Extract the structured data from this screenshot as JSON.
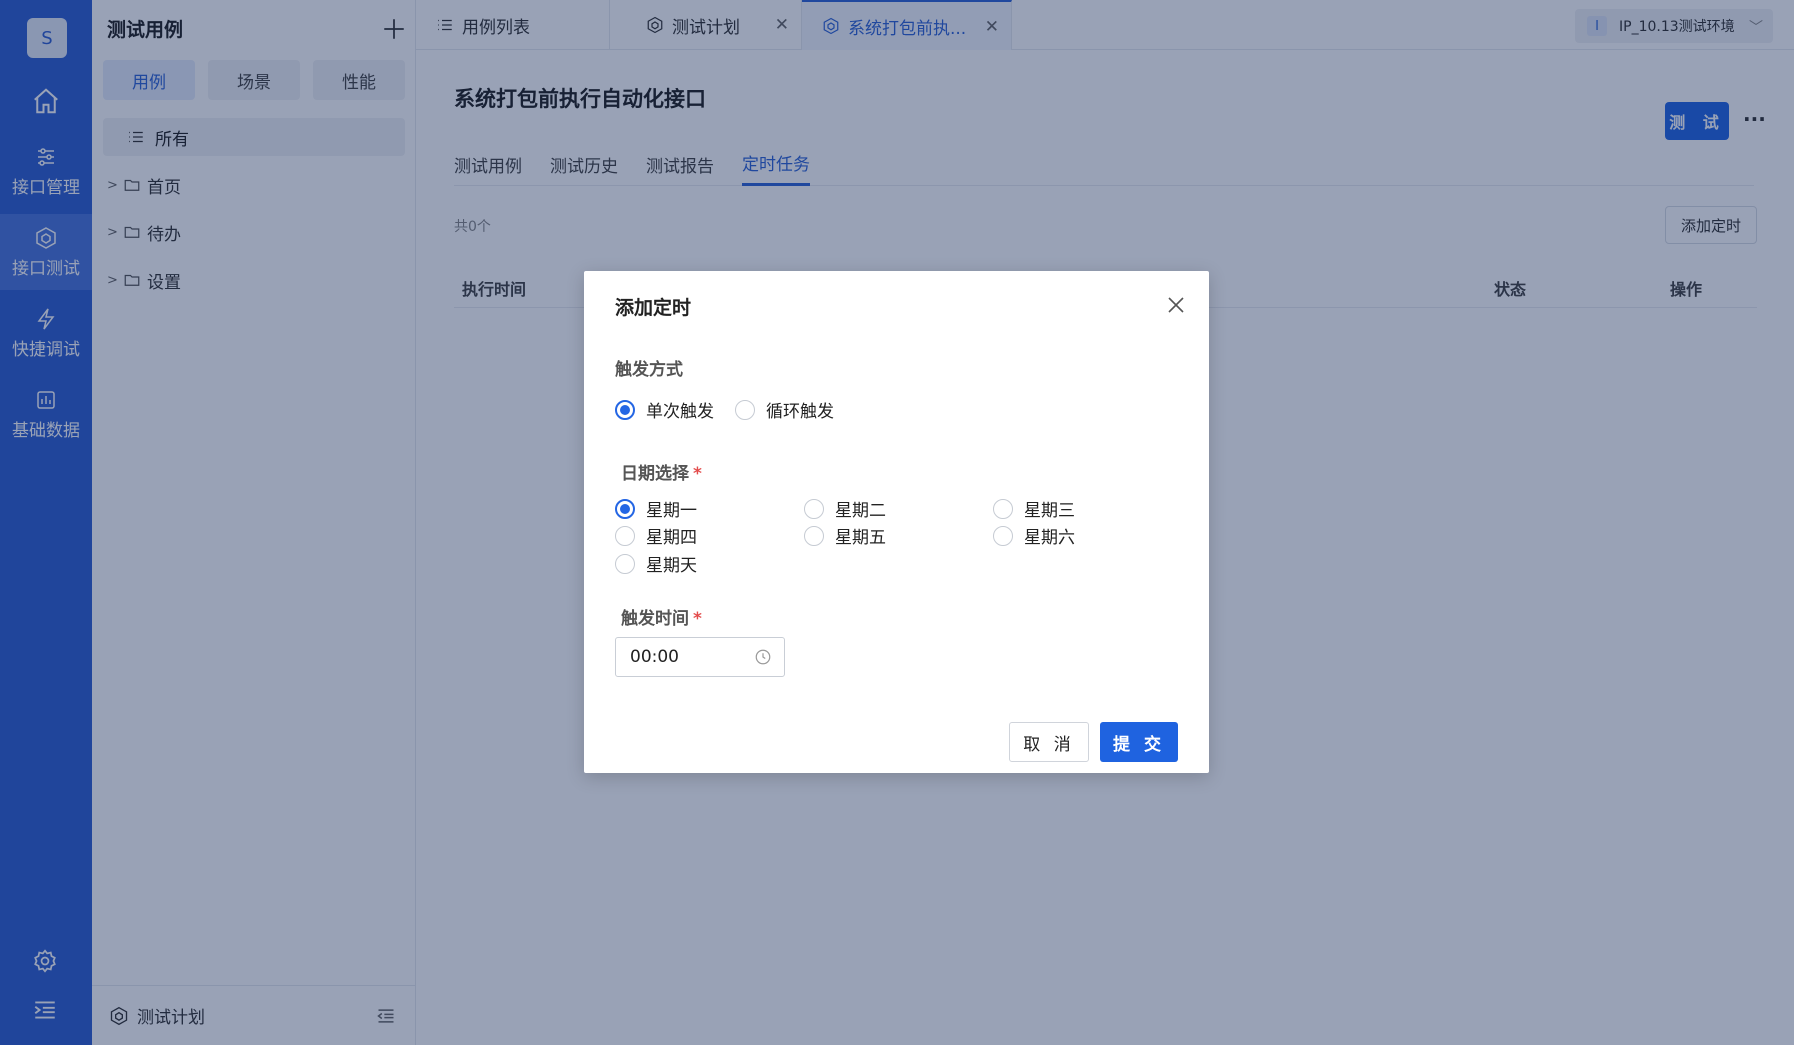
{
  "nav": {
    "avatar": "S",
    "items": [
      {
        "label": "接口管理",
        "icon": "sliders-icon"
      },
      {
        "label": "接口测试",
        "icon": "cube-icon"
      },
      {
        "label": "快捷调试",
        "icon": "lightning-icon"
      },
      {
        "label": "基础数据",
        "icon": "chart-icon"
      }
    ]
  },
  "sidebar": {
    "title": "测试用例",
    "segments": [
      "用例",
      "场景",
      "性能"
    ],
    "tree": {
      "all": "所有",
      "folders": [
        "首页",
        "待办",
        "设置"
      ]
    },
    "footer": "测试计划"
  },
  "tabs": [
    {
      "label": "用例列表"
    },
    {
      "label": "测试计划"
    },
    {
      "label": "系统打包前执..."
    }
  ],
  "environment": {
    "badge": "I",
    "label": "IP_10.13测试环境"
  },
  "main": {
    "title": "系统打包前执行自动化接口",
    "run_button": "测 试",
    "more": "···",
    "subtabs": [
      "测试用例",
      "测试历史",
      "测试报告",
      "定时任务"
    ],
    "count": "共0个",
    "add_timer": "添加定时",
    "columns": [
      "执行时间",
      "状态",
      "操作"
    ]
  },
  "dialog": {
    "title": "添加定时",
    "trigger_label": "触发方式",
    "trigger_options": [
      "单次触发",
      "循环触发"
    ],
    "trigger_selected": "单次触发",
    "date_label": "日期选择",
    "weekdays": [
      "星期一",
      "星期二",
      "星期三",
      "星期四",
      "星期五",
      "星期六",
      "星期天"
    ],
    "weekday_selected": "星期一",
    "time_label": "触发时间",
    "time_value": "00:00",
    "cancel": "取 消",
    "submit": "提 交"
  },
  "colors": {
    "nav_bg": "#2f5fd0",
    "accent": "#2466e4",
    "required": "#e34d4d",
    "overlay": "rgba(12,33,80,0.42)"
  }
}
